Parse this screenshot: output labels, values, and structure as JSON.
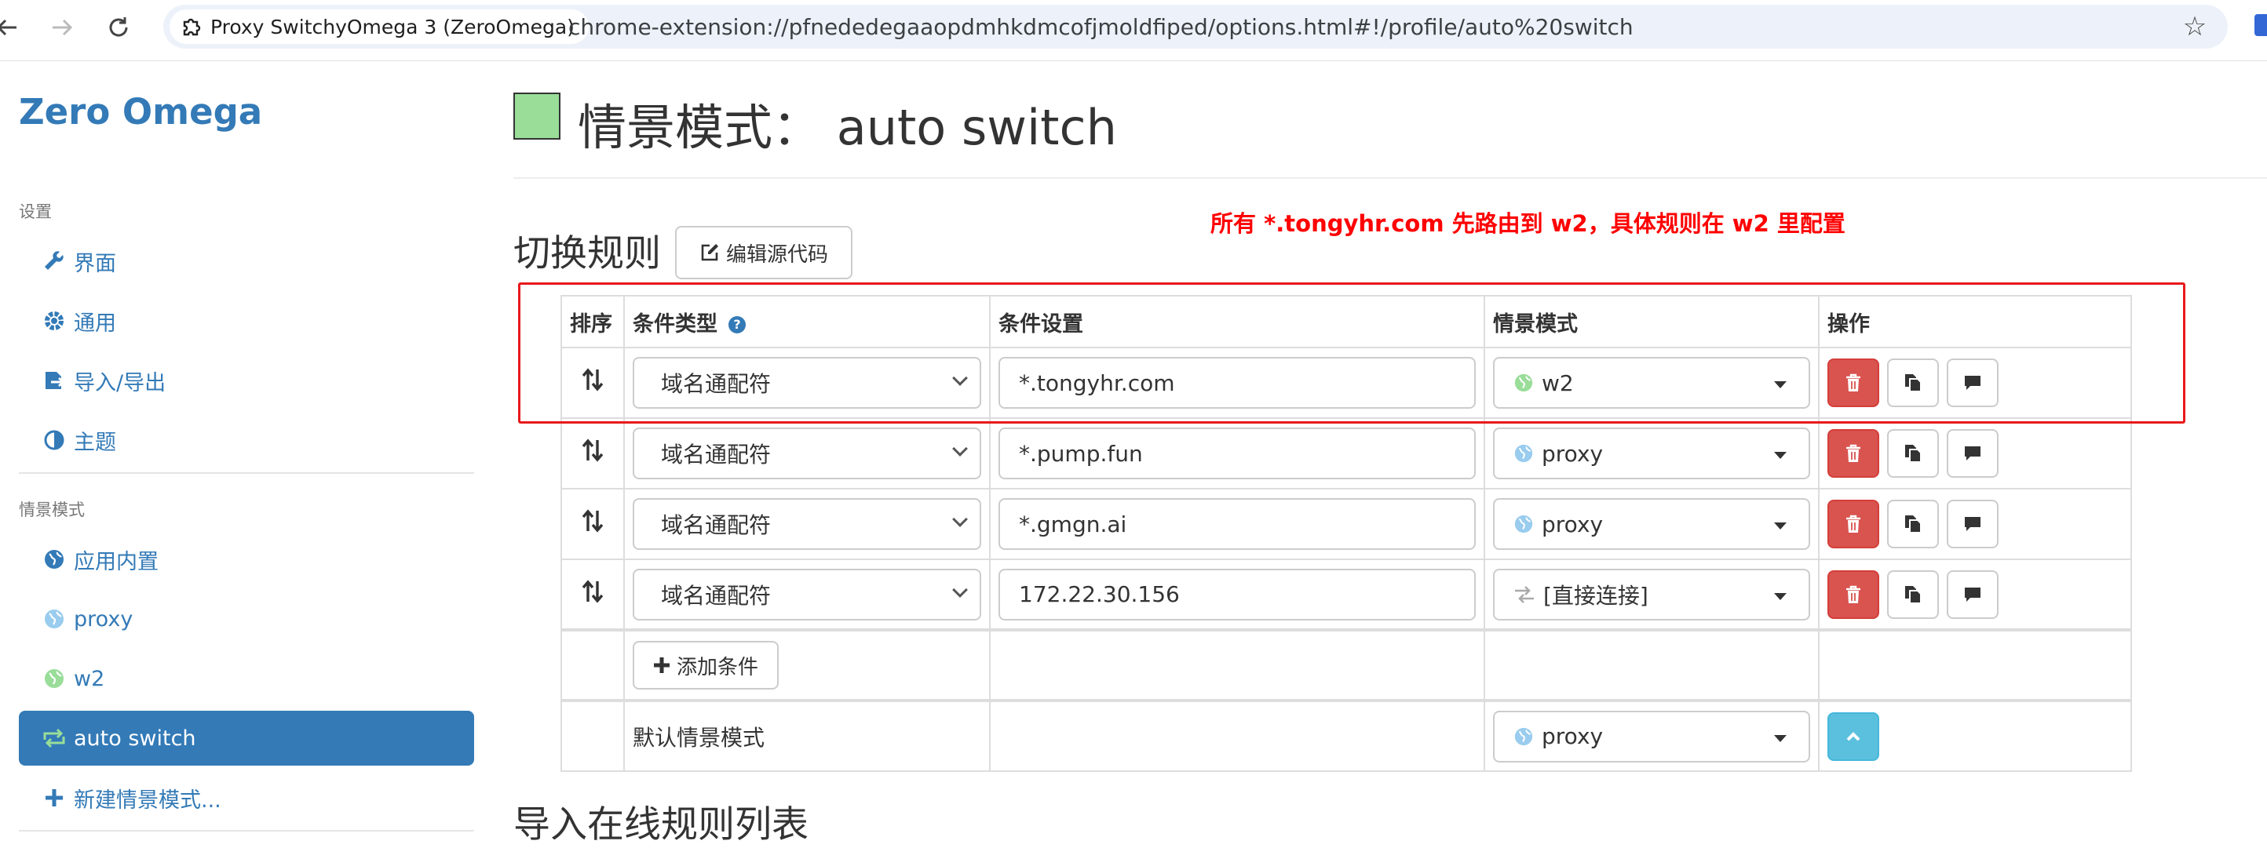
{
  "browser": {
    "tab_title": "Proxy SwitchyOmega 3 (ZeroOmega)",
    "url": "chrome-extension://pfnededegaaopdmhkdmcofjmoldfiped/options.html#!/profile/auto%20switch"
  },
  "sidebar": {
    "brand": "Zero Omega",
    "settings_header": "设置",
    "settings_items": [
      {
        "label": "界面",
        "icon": "wrench-icon"
      },
      {
        "label": "通用",
        "icon": "gear-icon"
      },
      {
        "label": "导入/导出",
        "icon": "import-export-icon"
      },
      {
        "label": "主题",
        "icon": "theme-icon"
      }
    ],
    "profiles_header": "情景模式",
    "profile_items": [
      {
        "label": "应用内置",
        "icon": "globe-icon"
      },
      {
        "label": "proxy",
        "icon": "globe-icon",
        "color": "#99ccee"
      },
      {
        "label": "w2",
        "icon": "globe-icon",
        "color": "#99dd99"
      },
      {
        "label": "auto switch",
        "icon": "switch-icon",
        "active": true
      },
      {
        "label": "新建情景模式...",
        "icon": "plus-icon"
      }
    ]
  },
  "main": {
    "profile_color": "#99dd99",
    "title": "情景模式： auto switch",
    "switch_rules_title": "切换规则",
    "edit_source_button": "编辑源代码",
    "annotation": "所有 *.tongyhr.com 先路由到 w2，具体规则在 w2 里配置",
    "table": {
      "headers": {
        "sort": "排序",
        "condition_type": "条件类型",
        "condition": "条件设置",
        "profile": "情景模式",
        "actions": "操作"
      },
      "rows": [
        {
          "type": "域名通配符",
          "condition": "*.tongyhr.com",
          "profile": "w2",
          "profile_icon": "globe-icon",
          "profile_color": "#99dd99"
        },
        {
          "type": "域名通配符",
          "condition": "*.pump.fun",
          "profile": "proxy",
          "profile_icon": "globe-icon",
          "profile_color": "#99ccee"
        },
        {
          "type": "域名通配符",
          "condition": "*.gmgn.ai",
          "profile": "proxy",
          "profile_icon": "globe-icon",
          "profile_color": "#99ccee"
        },
        {
          "type": "域名通配符",
          "condition": "172.22.30.156",
          "profile": "[直接连接]",
          "profile_icon": "direct-icon",
          "profile_color": "#aaaaaa"
        }
      ],
      "add_condition_button": "添加条件",
      "default_label": "默认情景模式",
      "default_profile": "proxy"
    },
    "import_rules_title": "导入在线规则列表"
  },
  "colors": {
    "link": "#337ab7",
    "danger": "#d9534f",
    "info": "#5bc0de",
    "annotation": "#ff0000"
  }
}
